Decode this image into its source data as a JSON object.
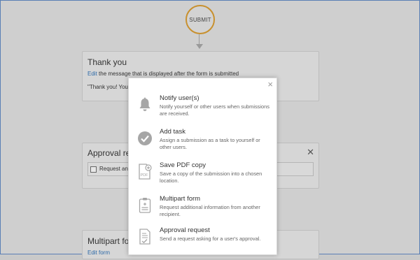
{
  "flow": {
    "submit_label": "SUBMIT",
    "thanks": {
      "title": "Thank you",
      "edit_link": "Edit",
      "edit_rest": "the message that is displayed after the form is submitted",
      "quote": "\"Thank you! You"
    },
    "approval": {
      "title": "Approval rec",
      "field_label": "Request an"
    },
    "multipart": {
      "title": "Multipart forr",
      "edit_link": "Edit form"
    }
  },
  "modal": {
    "close_glyph": "×",
    "options": [
      {
        "title": "Notify user(s)",
        "desc": "Notify yourself or other users when submissions are received.",
        "icon": "bell-icon"
      },
      {
        "title": "Add task",
        "desc": "Assign a submission as a task to yourself or other users.",
        "icon": "check-circle-icon"
      },
      {
        "title": "Save PDF copy",
        "desc": "Save a copy of the submission into a chosen location.",
        "icon": "pdf-file-icon"
      },
      {
        "title": "Multipart form",
        "desc": "Request additional information from another recipient.",
        "icon": "clipboard-form-icon"
      },
      {
        "title": "Approval request",
        "desc": "Send a request asking for a user's approval.",
        "icon": "approval-document-icon"
      }
    ]
  },
  "colors": {
    "accent_link": "#2e6aa8",
    "submit_ring": "#c8902e",
    "icon_gray": "#a6a6a6"
  }
}
